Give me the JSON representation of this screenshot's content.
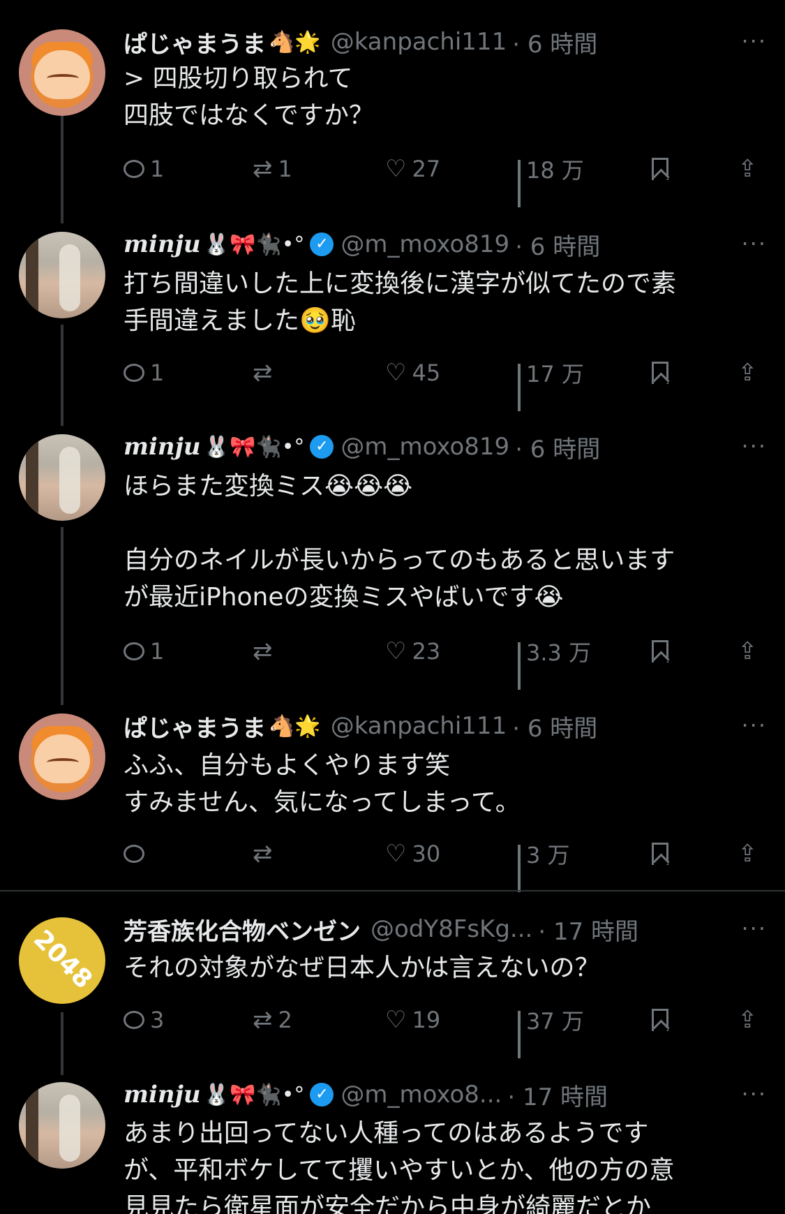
{
  "tweets": [
    {
      "name": "ぱじゃまうま",
      "emojis": "🐴🌟",
      "handle": "@kanpachi111",
      "time": "· 6 時間",
      "more": "···",
      "lines": [
        "> 四股切り取られて",
        "四肢ではなくですか？"
      ],
      "replies": "1",
      "retweets": "1",
      "likes": "27",
      "views": "18 万"
    },
    {
      "name": "minju",
      "emojis": "🐰🎀🐈‍⬛•°",
      "handle": "@m_moxo819",
      "time": "· 6 時間",
      "more": "···",
      "lines": [
        "打ち間違いした上に変換後に漢字が似てたので素",
        "手間違えました🥹恥"
      ],
      "replies": "1",
      "retweets": "",
      "likes": "45",
      "views": "17 万"
    },
    {
      "name": "minju",
      "emojis": "🐰🎀🐈‍⬛•°",
      "handle": "@m_moxo819",
      "time": "· 6 時間",
      "more": "···",
      "lines": [
        "ほらまた変換ミス😭😭😭",
        "",
        "自分のネイルが長いからってのもあると思います",
        "が最近iPhoneの変換ミスやばいです😭"
      ],
      "replies": "1",
      "retweets": "",
      "likes": "23",
      "views": "3.3 万"
    },
    {
      "name": "ぱじゃまうま",
      "emojis": "🐴🌟",
      "handle": "@kanpachi111",
      "time": "· 6 時間",
      "more": "···",
      "lines": [
        "ふふ、自分もよくやります笑",
        "すみません、気になってしまって。"
      ],
      "replies": "",
      "retweets": "",
      "likes": "30",
      "views": "3 万"
    },
    {
      "name": "芳香族化合物ベンゼン",
      "emojis": "",
      "handle": "@odY8FsKg...",
      "time": "· 17 時間",
      "more": "···",
      "avatar_text": "2048",
      "lines": [
        "それの対象がなぜ日本人かは言えないの？"
      ],
      "replies": "3",
      "retweets": "2",
      "likes": "19",
      "views": "37 万"
    },
    {
      "name": "minju",
      "emojis": "🐰🎀🐈‍⬛•°",
      "handle": "@m_moxo8...",
      "time": "· 17 時間",
      "more": "···",
      "lines": [
        "あまり出回ってない人種ってのはあるようです",
        "が、平和ボケしてて攫いやすいとか、他の方の意",
        "見見たら衛星面が安全だから中身が綺麗だとか"
      ]
    }
  ],
  "icons": {
    "reply": "reply-icon",
    "retweet": "retweet-icon",
    "like": "heart-icon",
    "views": "views-icon",
    "bookmark": "bookmark-icon",
    "share": "share-icon",
    "verified": "verified-badge-icon"
  },
  "colors": {
    "background": "#000000",
    "text": "#e7e9ea",
    "secondary": "#71767b",
    "verified": "#1d9bf0",
    "divider": "#2f3336"
  },
  "glyphs": {
    "retweet": "⇄",
    "heart": "♡",
    "share": "⇪",
    "check": "✓"
  }
}
